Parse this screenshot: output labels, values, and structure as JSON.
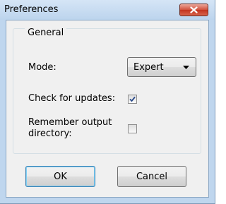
{
  "window": {
    "title": "Preferences"
  },
  "general": {
    "legend": "General",
    "mode_label": "Mode:",
    "mode_value": "Expert",
    "check_updates_label": "Check for updates:",
    "check_updates_checked": true,
    "remember_label_line1": "Remember output",
    "remember_label_line2": "directory:",
    "remember_checked": false
  },
  "buttons": {
    "ok": "OK",
    "cancel": "Cancel"
  }
}
